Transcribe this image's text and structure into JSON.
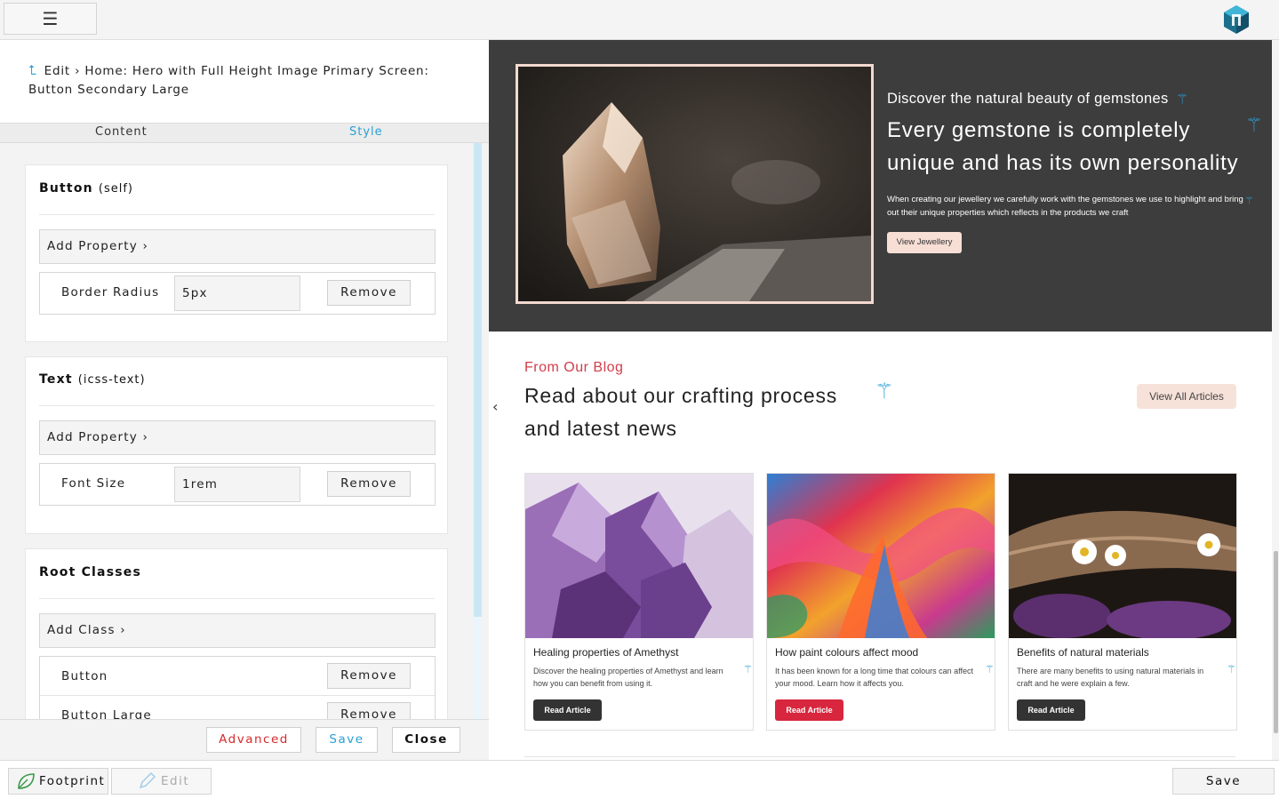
{
  "topbar": {
    "menu_icon": "☰",
    "logo": "brand-logo"
  },
  "editor": {
    "breadcrumb_icon": "⮤",
    "breadcrumb": "Edit › Home: Hero with Full Height Image Primary Screen: Button Secondary Large",
    "tabs": {
      "content": "Content",
      "style": "Style"
    },
    "sections": {
      "button": {
        "title": "Button",
        "subtitle": "(self)",
        "add_label": "Add Property ›",
        "property": {
          "label": "Border Radius",
          "value": "5px",
          "remove": "Remove"
        }
      },
      "text": {
        "title": "Text",
        "subtitle": "(icss-text)",
        "add_label": "Add Property ›",
        "property": {
          "label": "Font Size",
          "value": "1rem",
          "remove": "Remove"
        }
      },
      "root": {
        "title": "Root Classes",
        "add_label": "Add Class ›",
        "classes": [
          {
            "label": "Button",
            "remove": "Remove"
          },
          {
            "label": "Button Large",
            "remove": "Remove"
          }
        ]
      }
    },
    "footer": {
      "advanced": "Advanced",
      "save": "Save",
      "close": "Close"
    }
  },
  "preview": {
    "hero": {
      "kicker": "Discover the natural beauty of gemstones",
      "heading": "Every gemstone is completely unique and has its own personality",
      "text": "When creating our jewellery we carefully work with the gemstones we use to highlight and bring out their unique properties which reflects in the products we craft",
      "button": "View Jewellery"
    },
    "blog": {
      "kicker": "From Our Blog",
      "heading": "Read about our crafting process and latest news",
      "view_all": "View All Articles",
      "prev_icon": "‹",
      "posts": [
        {
          "title": "Healing properties of Amethyst",
          "text": "Discover the healing properties of Amethyst and learn how you can benefit from using it.",
          "button": "Read Article",
          "button_color": "#333333"
        },
        {
          "title": "How paint colours affect mood",
          "text": "It has been known for a long time that colours can affect your mood. Learn how it affects you.",
          "button": "Read Article",
          "button_color": "#d7263d"
        },
        {
          "title": "Benefits of natural materials",
          "text": "There are many benefits to using natural materials in craft and he were explain a few.",
          "button": "Read Article",
          "button_color": "#333333"
        }
      ]
    },
    "wand_icon": "magic-wand-icon"
  },
  "bottombar": {
    "footprint": "Footprint",
    "edit": "Edit",
    "save": "Save"
  },
  "colors": {
    "accent": "#2a9fd6",
    "danger": "#d62a2a",
    "hero_bg": "#3d3d3d",
    "blog_kicker": "#d23c4a"
  }
}
